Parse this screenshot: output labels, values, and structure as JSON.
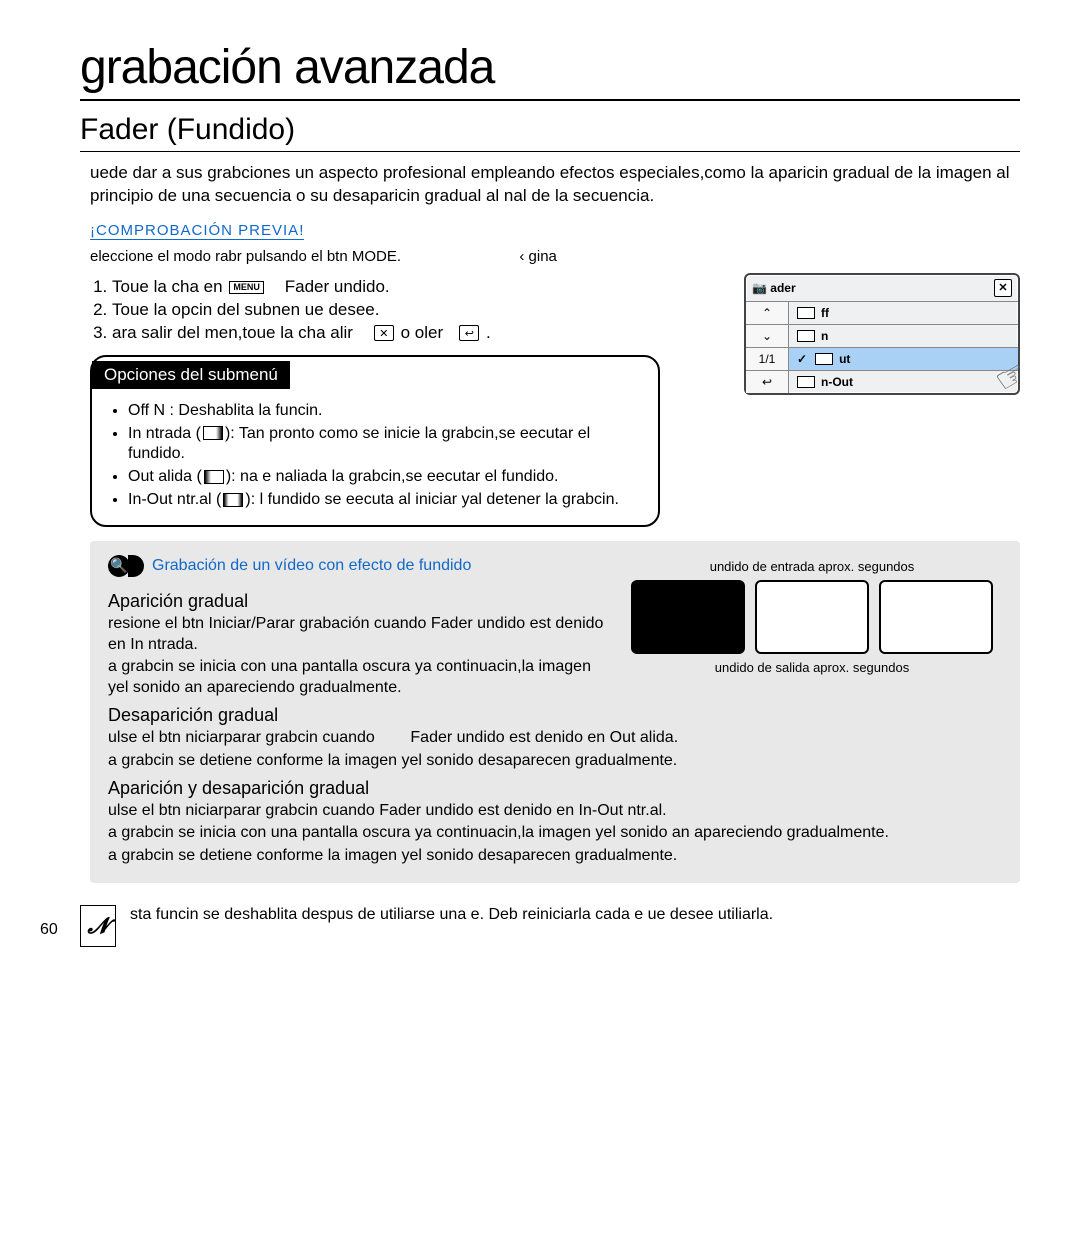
{
  "page": {
    "number": "60",
    "title": "grabación avanzada",
    "section": "Fader (Fundido)",
    "intro": "uede dar a sus grabciones un aspecto profesional empleando efectos especiales,como la aparicin gradual de la imagen al principio de una secuencia o su desaparicin gradual al nal de la secuencia."
  },
  "precheck": {
    "label": "¡COMPROBACIÓN PREVIA!",
    "text_a": "eleccione el modo rabr pulsando el btn ",
    "text_mode": "MODE",
    "text_b": ".",
    "text_page": "‹ gina"
  },
  "steps": [
    {
      "n": "1.",
      "a": "Toue la cha en",
      "tag": "MENU",
      "b": "Fader undido."
    },
    {
      "n": "2.",
      "a": "Toue la opcin del subnen ue desee."
    },
    {
      "n": "3.",
      "a": "ara salir del men,toue la cha alir",
      "icon1": "✕",
      "mid": "o oler",
      "icon2": "↩",
      "end": "."
    }
  ],
  "submenu": {
    "header": "Opciones del submenú",
    "items": [
      {
        "label": "Off",
        "sub": "N",
        "desc": ": Deshablita la funcin."
      },
      {
        "label": "In",
        "sub": "ntrada (",
        "icon": "in",
        "desc": "): Tan pronto como se inicie la grabcin,se eecutar el fundido."
      },
      {
        "label": "Out",
        "sub": "alida (",
        "icon": "out",
        "desc": "): na e naliada la grabcin,se eecutar el fundido."
      },
      {
        "label": "In-Out",
        "sub": "ntr.al (",
        "icon": "inout",
        "desc": "): l fundido se eecuta al iniciar yal detener la grabcin."
      }
    ]
  },
  "cam_ui": {
    "title": "ader",
    "items": [
      {
        "label": "ff",
        "selected": false
      },
      {
        "label": "n",
        "selected": false
      },
      {
        "label": "ut",
        "selected": true
      },
      {
        "label": "n-Out",
        "selected": false
      }
    ],
    "left_buttons": [
      "⌃",
      "⌄",
      "1/1",
      "↩"
    ]
  },
  "howto": {
    "pill": "Grabación de un vídeo con efecto de fundido",
    "h1": "Aparición gradual",
    "p1a": "resione el btn ",
    "p1b": "Iniciar/Parar grabación",
    "p1c": " cuando ",
    "p1d": "Fader",
    "p1e": " undido est denido en ",
    "p1f": "In",
    "p1g": " ntrada.",
    "p2": "a grabcin se inicia con una pantalla oscura ya continuacin,la imagen yel sonido an apareciendo gradualmente.",
    "h2": "Desaparición gradual",
    "p3a": "ulse el btn niciarparar grabcin cuando",
    "p3b": "Fader",
    "p3c": " undido est denido en ",
    "p3d": "Out",
    "p3e": " alida.",
    "p4": "a grabcin se detiene conforme la imagen yel sonido desaparecen gradualmente.",
    "h3": "Aparición y desaparición gradual",
    "p5a": "ulse el btn niciarparar grabcin cuando ",
    "p5b": "Fader",
    "p5c": " undido est denido en ",
    "p5d": "In-Out",
    "p5e": " ntr.al.",
    "p6": "a grabcin se inicia con una pantalla oscura ya continuacin,la imagen yel sonido an apareciendo gradualmente.",
    "p7": "a grabcin se detiene conforme la imagen yel sonido desaparecen gradualmente.",
    "caption_in": "undido de entrada aprox.  segundos",
    "caption_out": "undido de salida aprox.  segundos"
  },
  "note": "sta funcin se deshablita despus de utiliarse una e. Deb reiniciarla cada e ue desee utiliarla."
}
